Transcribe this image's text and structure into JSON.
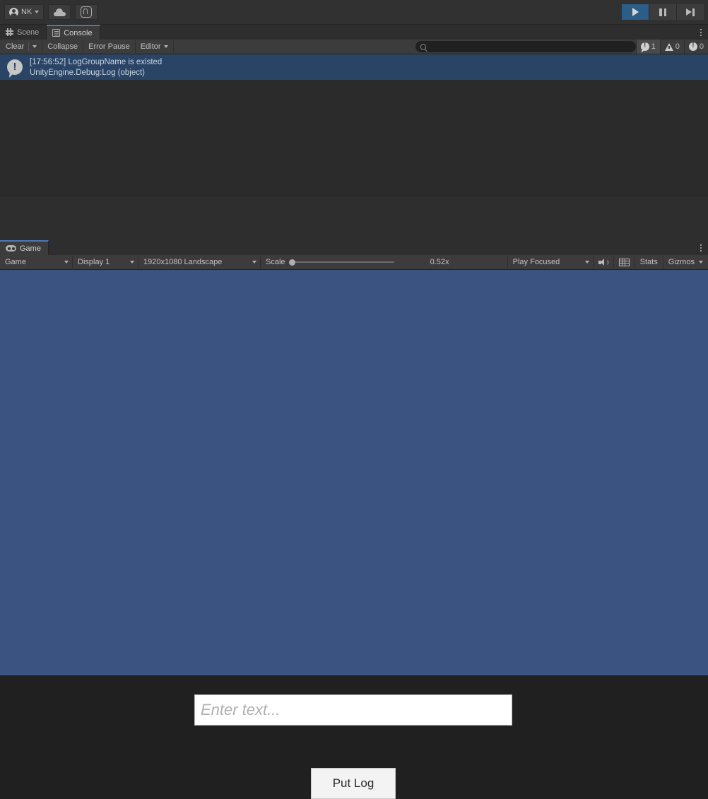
{
  "toolbar": {
    "account_label": "NK",
    "account_icon": "avatar-icon",
    "cloud_icon": "cloud-icon",
    "collab_icon": "collab-icon",
    "play_icon": "play-icon",
    "pause_icon": "pause-icon",
    "step_icon": "step-icon",
    "play_active": true
  },
  "console_panel": {
    "tabs": [
      {
        "label": "Scene",
        "icon": "grid-hash-icon",
        "active": false
      },
      {
        "label": "Console",
        "icon": "console-icon",
        "active": true
      }
    ],
    "kebab_icon": "more-options-icon",
    "toolbar": {
      "clear_label": "Clear",
      "clear_dropdown_icon": "chevron-down-icon",
      "collapse_label": "Collapse",
      "error_pause_label": "Error Pause",
      "editor_label": "Editor",
      "editor_dropdown_icon": "chevron-down-icon",
      "search_value": "",
      "search_placeholder": "",
      "search_icon": "search-icon",
      "counters": {
        "info_icon": "info-log-icon",
        "info_count": "1",
        "warning_icon": "warning-icon",
        "warning_count": "0",
        "error_icon": "error-icon",
        "error_count": "0"
      }
    },
    "log_entries": [
      {
        "icon": "info-log-icon",
        "line1": "[17:56:52] LogGroupName is existed",
        "line2": "UnityEngine.Debug:Log (object)",
        "selected": true
      }
    ]
  },
  "game_panel": {
    "tabs": [
      {
        "label": "Game",
        "icon": "gamepad-icon",
        "active": true
      }
    ],
    "kebab_icon": "more-options-icon",
    "toolbar": {
      "view_mode": "Game",
      "view_mode_icon": "chevron-down-icon",
      "display": "Display 1",
      "display_icon": "chevron-down-icon",
      "resolution": "1920x1080 Landscape",
      "resolution_icon": "chevron-down-icon",
      "scale_label": "Scale",
      "scale_value": "0.52x",
      "scale_percent": 0,
      "play_mode": "Play Focused",
      "play_mode_icon": "chevron-down-icon",
      "mute_audio_icon": "speaker-icon",
      "aspect_icon": "grid-icon",
      "stats_label": "Stats",
      "gizmos_label": "Gizmos",
      "gizmos_icon": "chevron-down-icon"
    },
    "content": {
      "background_color": "#3a5380",
      "input_field": {
        "placeholder": "Enter text...",
        "value": ""
      },
      "button": {
        "label": "Put Log"
      }
    }
  }
}
